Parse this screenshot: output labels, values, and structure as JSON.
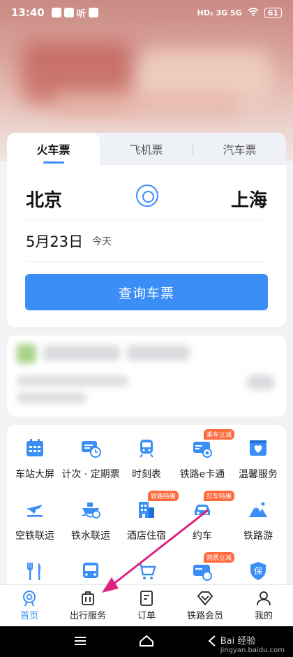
{
  "status_bar": {
    "time": "13:40",
    "ting": "听",
    "right_text": "HD₂  3G  5G",
    "battery": "61"
  },
  "ticket_tabs": [
    {
      "label": "火车票",
      "active": true
    },
    {
      "label": "飞机票",
      "active": false
    },
    {
      "label": "汽车票",
      "active": false
    }
  ],
  "search_card": {
    "from_city": "北京",
    "to_city": "上海",
    "date": "5月23日",
    "date_sub": "今天",
    "search_label": "查询车票"
  },
  "services": [
    {
      "label": "车站大屏",
      "icon": "station-screen-icon",
      "badge": ""
    },
    {
      "label": "计次 · 定期票",
      "icon": "ticket-pass-icon",
      "badge": ""
    },
    {
      "label": "时刻表",
      "icon": "train-timetable-icon",
      "badge": ""
    },
    {
      "label": "铁路e卡通",
      "icon": "rail-ecard-icon",
      "badge": "乘车立减"
    },
    {
      "label": "温馨服务",
      "icon": "heart-service-icon",
      "badge": ""
    },
    {
      "label": "空铁联运",
      "icon": "plane-rail-icon",
      "badge": ""
    },
    {
      "label": "铁水联运",
      "icon": "ship-rail-icon",
      "badge": ""
    },
    {
      "label": "酒店住宿",
      "icon": "hotel-icon",
      "badge": "铁路特惠"
    },
    {
      "label": "约车",
      "icon": "car-icon",
      "badge": "打车特惠"
    },
    {
      "label": "铁路游",
      "icon": "mountain-travel-icon",
      "badge": ""
    },
    {
      "label": "",
      "icon": "fork-knife-icon",
      "badge": ""
    },
    {
      "label": "",
      "icon": "bus-icon",
      "badge": ""
    },
    {
      "label": "",
      "icon": "cart-icon",
      "badge": ""
    },
    {
      "label": "",
      "icon": "card-train-icon",
      "badge": "购票立减"
    },
    {
      "label": "",
      "icon": "shield-insurance-icon",
      "badge": ""
    }
  ],
  "shield_text": "保",
  "bottom_nav": [
    {
      "label": "首页",
      "icon": "home-train-icon",
      "active": true
    },
    {
      "label": "出行服务",
      "icon": "suitcase-icon",
      "active": false
    },
    {
      "label": "订单",
      "icon": "order-list-icon",
      "active": false
    },
    {
      "label": "铁路会员",
      "icon": "diamond-member-icon",
      "active": false
    },
    {
      "label": "我的",
      "icon": "person-icon",
      "active": false
    }
  ],
  "watermark": {
    "brand": "Bai 经验",
    "url": "jingyan.baidu.com"
  },
  "colors": {
    "accent": "#3a8ef6",
    "badge": "#ff6a3d",
    "arrow": "#e0207f"
  }
}
